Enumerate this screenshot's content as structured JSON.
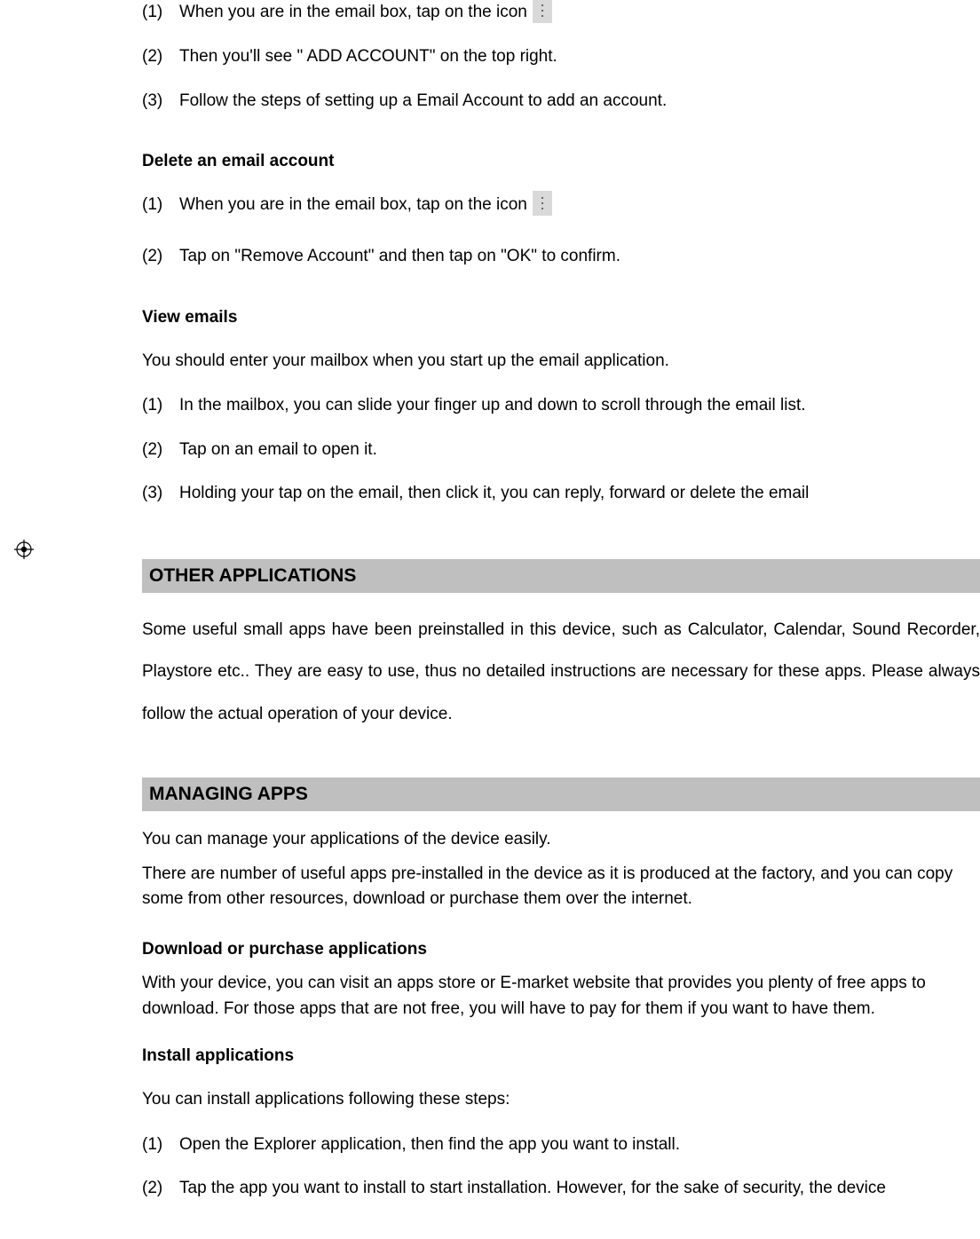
{
  "add_account": {
    "items": [
      {
        "num": "(1)",
        "text": "When you are in the email box, tap on the icon",
        "has_icon": true
      },
      {
        "num": "(2)",
        "text": "Then you'll see \" ADD ACCOUNT\" on the top right."
      },
      {
        "num": "(3)",
        "text": "Follow the steps of setting up a Email Account to add an account."
      }
    ]
  },
  "delete_heading": "Delete an email account",
  "delete_account": {
    "items": [
      {
        "num": "(1)",
        "text": "When you are in the email box, tap on the icon",
        "has_icon": true
      },
      {
        "num": "(2)",
        "text": "Tap on \"Remove Account\" and then tap on \"OK\" to confirm."
      }
    ]
  },
  "view_heading": "View emails",
  "view_intro": "You should enter your mailbox when you start up the email application.",
  "view_emails": {
    "items": [
      {
        "num": "(1)",
        "text": "In the mailbox, you can slide your finger up and down to scroll through the email list."
      },
      {
        "num": "(2)",
        "text": "Tap on an email to open it."
      },
      {
        "num": "(3)",
        "text": "Holding your tap on the email, then click it, you can reply, forward or delete the email"
      }
    ]
  },
  "other_apps_heading": "OTHER APPLICATIONS",
  "other_apps_para": "Some useful small apps have been preinstalled in this device, such as Calculator, Calendar, Sound Recorder, Playstore etc.. They are easy to use, thus no detailed instructions are necessary for these apps. Please always follow the actual operation of your device.",
  "managing_heading": "MANAGING APPS",
  "managing_para1": "You can manage your applications of the device easily.",
  "managing_para2": "There are number of useful apps pre-installed in the device as it is produced at the factory, and you can copy some from other resources, download or purchase them over the internet.",
  "download_heading": "Download or purchase applications",
  "download_para": "With your device, you can visit an apps store or E-market website that provides you plenty of free apps to download. For those apps that are not free, you will have to pay for them if you want to have them.",
  "install_heading": "Install applications",
  "install_intro": "You can install applications following these steps:",
  "install": {
    "items": [
      {
        "num": "(1)",
        "text": "Open the Explorer application, then find the app you want to install."
      },
      {
        "num": "(2)",
        "text": "Tap the app you want to install to start installation. However, for the sake of security, the device"
      }
    ]
  }
}
